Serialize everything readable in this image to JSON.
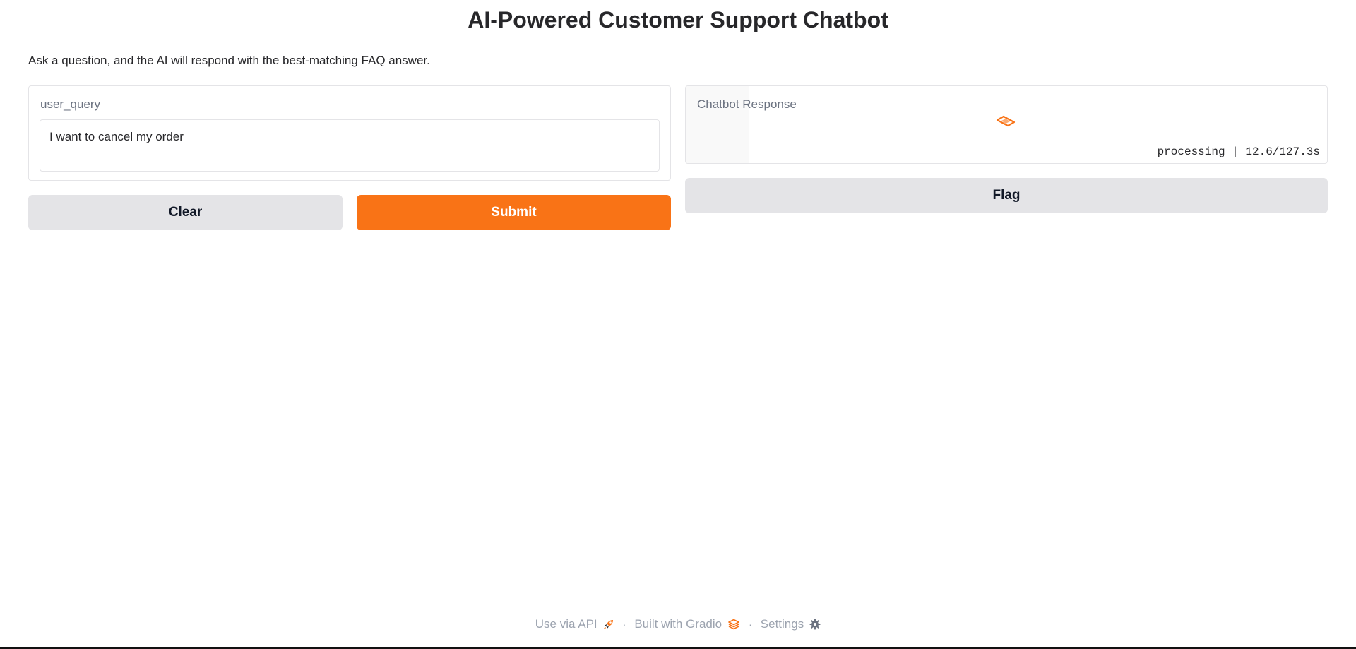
{
  "title": "AI-Powered Customer Support Chatbot",
  "description": "Ask a question, and the AI will respond with the best-matching FAQ answer.",
  "input_panel": {
    "label": "user_query",
    "value": "I want to cancel my order"
  },
  "output_panel": {
    "label": "Chatbot Response",
    "status_text": "processing | 12.6/127.3s",
    "elapsed_seconds": 12.6,
    "estimated_seconds": 127.3,
    "progress_fraction": 0.099,
    "loader_icon": "gradio-loader-icon"
  },
  "buttons": {
    "clear": "Clear",
    "submit": "Submit",
    "flag": "Flag"
  },
  "footer": {
    "api_label": "Use via API",
    "api_icon": "rocket-icon",
    "built_label": "Built with Gradio",
    "built_icon": "gradio-logo-icon",
    "settings_label": "Settings",
    "settings_icon": "gear-icon",
    "separator": "·"
  },
  "colors": {
    "accent": "#f97316",
    "button_secondary": "#e4e4e7",
    "border": "#e4e4e7",
    "muted_text": "#9ca3af"
  }
}
